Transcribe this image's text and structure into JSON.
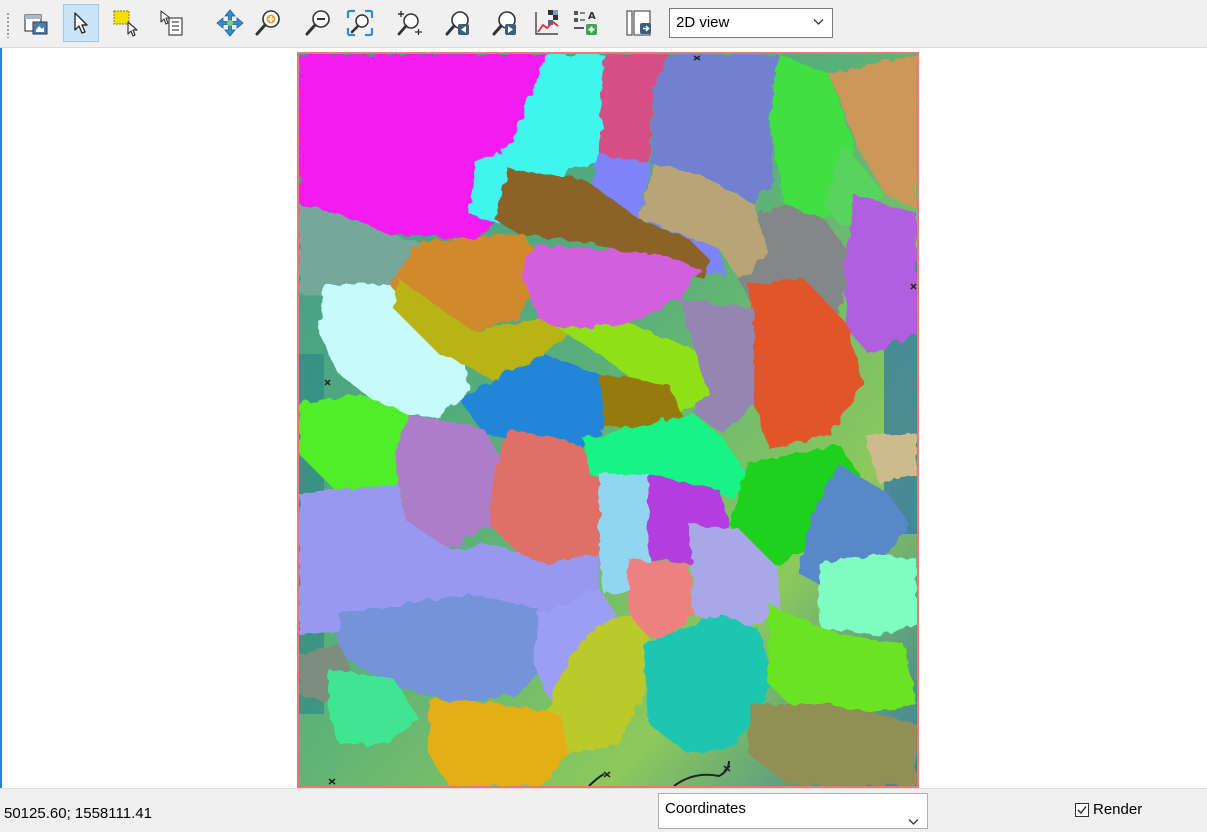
{
  "toolbar": {
    "buttons": [
      {
        "id": "map-layer",
        "icon": "map-window-icon"
      },
      {
        "id": "select",
        "icon": "arrow-pointer-icon",
        "active": true
      },
      {
        "id": "select-rect",
        "icon": "select-rectangle-icon"
      },
      {
        "id": "identify",
        "icon": "identify-info-icon"
      },
      {
        "id": "pan",
        "icon": "pan-arrows-icon"
      },
      {
        "id": "zoom-in",
        "icon": "zoom-in-icon"
      },
      {
        "id": "zoom-out",
        "icon": "zoom-out-icon"
      },
      {
        "id": "zoom-extent",
        "icon": "zoom-full-extent-icon"
      },
      {
        "id": "zoom-layer",
        "icon": "zoom-to-layer-icon"
      },
      {
        "id": "zoom-prev",
        "icon": "zoom-previous-icon"
      },
      {
        "id": "zoom-next",
        "icon": "zoom-next-icon"
      },
      {
        "id": "profile",
        "icon": "profile-chart-icon"
      },
      {
        "id": "legend",
        "icon": "legend-add-icon"
      },
      {
        "id": "export",
        "icon": "export-layout-icon"
      }
    ],
    "view_mode": "2D view"
  },
  "status": {
    "coordinates": "50125.60; 1558111.41",
    "coordinate_mode": "Coordinates",
    "render_label": "Render",
    "render_checked": true
  },
  "colors": {
    "accent": "#2d7fd3",
    "map_border": "#e07d78",
    "active_button": "#cce4f7"
  }
}
